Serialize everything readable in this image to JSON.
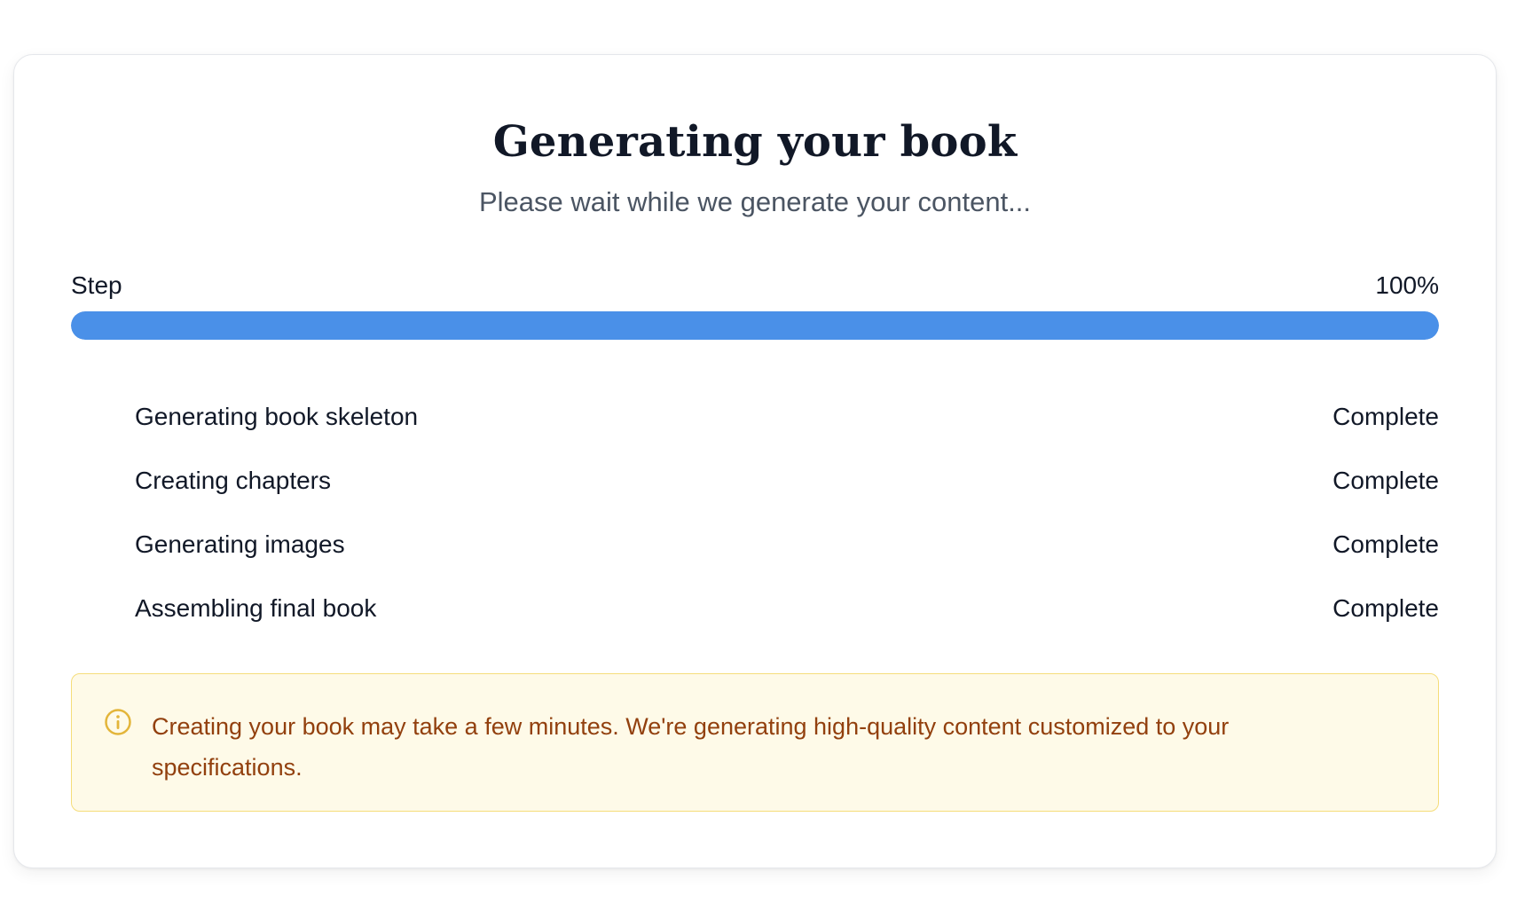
{
  "header": {
    "title": "Generating your book",
    "subtitle": "Please wait while we generate your content..."
  },
  "progress": {
    "label": "Step",
    "percent_text": "100%",
    "value": 1.0,
    "fill_color": "#4a90e8"
  },
  "steps": [
    {
      "label": "Generating book skeleton",
      "status": "Complete"
    },
    {
      "label": "Creating chapters",
      "status": "Complete"
    },
    {
      "label": "Generating images",
      "status": "Complete"
    },
    {
      "label": "Assembling final book",
      "status": "Complete"
    }
  ],
  "notice": {
    "icon": "info-icon",
    "text": "Creating your book may take a few minutes. We're generating high-quality content customized to your specifications.",
    "accent_color": "#e3b53a"
  }
}
